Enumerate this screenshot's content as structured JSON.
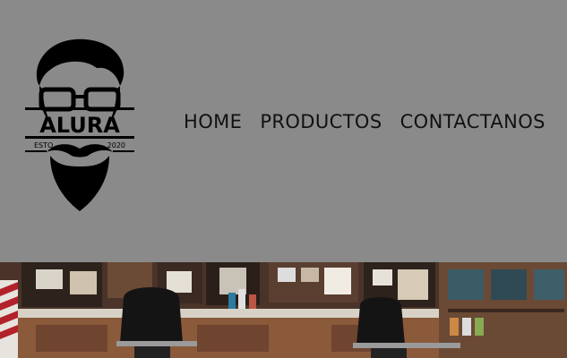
{
  "logo": {
    "brand": "ALURA",
    "left_text": "ESTO",
    "right_text": "2020"
  },
  "nav": {
    "items": [
      {
        "label": "HOME"
      },
      {
        "label": "PRODUCTOS"
      },
      {
        "label": "CONTACTANOS"
      }
    ]
  },
  "colors": {
    "header_bg": "#8a8a8a",
    "nav_text": "#111111",
    "logo": "#000000"
  },
  "hero": {
    "image": "barbershop-interior-photo"
  }
}
